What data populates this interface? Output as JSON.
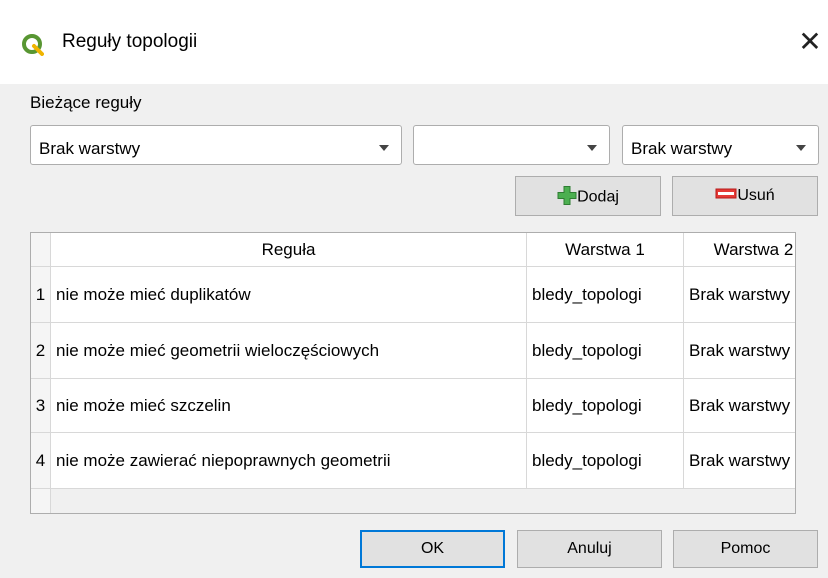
{
  "window": {
    "title": "Reguły topologii",
    "close_glyph": "✕"
  },
  "current_rules_label": "Bieżące reguły",
  "combos": {
    "layer1": {
      "value": "Brak warstwy"
    },
    "rule": {
      "value": ""
    },
    "layer2": {
      "value": "Brak warstwy"
    }
  },
  "actions": {
    "add_label": "Dodaj",
    "remove_label": "Usuń"
  },
  "table": {
    "headers": {
      "rule": "Reguła",
      "layer1": "Warstwa 1",
      "layer2": "Warstwa 2"
    },
    "rows": [
      {
        "num": "1",
        "rule": "nie może mieć duplikatów",
        "layer1": "bledy_topologi",
        "layer2": "Brak warstwy"
      },
      {
        "num": "2",
        "rule": "nie może mieć geometrii wieloczęściowych",
        "layer1": "bledy_topologi",
        "layer2": "Brak warstwy"
      },
      {
        "num": "3",
        "rule": "nie może mieć szczelin",
        "layer1": "bledy_topologi",
        "layer2": "Brak warstwy"
      },
      {
        "num": "4",
        "rule": "nie może zawierać niepoprawnych geometrii",
        "layer1": "bledy_topologi",
        "layer2": "Brak warstwy"
      }
    ]
  },
  "footer": {
    "ok_label": "OK",
    "cancel_label": "Anuluj",
    "help_label": "Pomoc"
  },
  "colors": {
    "qgis_green": "#589632",
    "add_green": "#4caf50",
    "remove_red": "#e53935",
    "focus_blue": "#0078d7"
  },
  "icons": {
    "app": "qgis-logo-icon",
    "add": "plus-icon",
    "remove": "minus-icon",
    "close": "close-icon"
  }
}
